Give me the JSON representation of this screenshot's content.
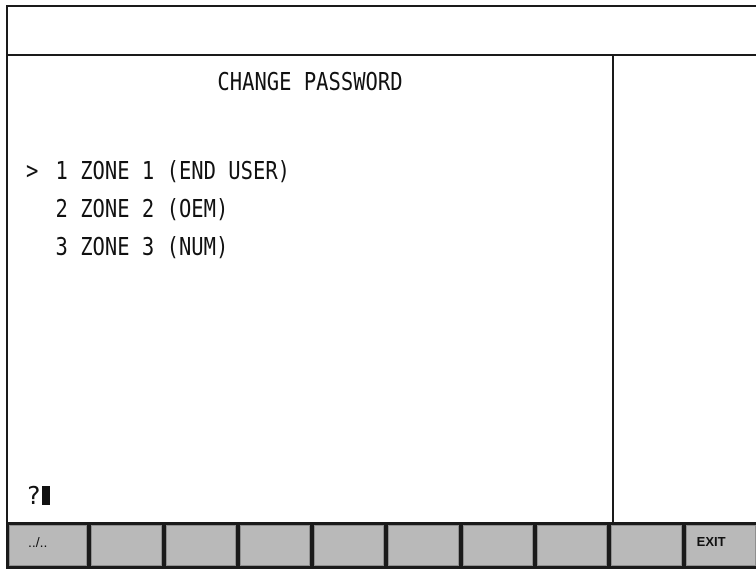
{
  "screen": {
    "title": "CHANGE PASSWORD",
    "menu_items": [
      {
        "cursor": ">",
        "text": "1 ZONE 1 (END USER)"
      },
      {
        "cursor": "",
        "text": "2 ZONE 2 (OEM)"
      },
      {
        "cursor": "",
        "text": "3 ZONE 3 (NUM)"
      }
    ],
    "prompt": "?"
  },
  "softkeys": [
    "../..",
    "",
    "",
    "",
    "",
    "",
    "",
    "",
    "",
    "EXIT"
  ]
}
